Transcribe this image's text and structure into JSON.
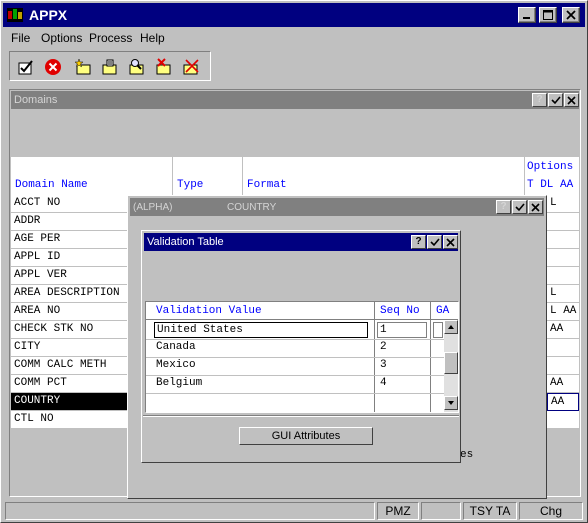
{
  "app": {
    "title": "APPX"
  },
  "menu": [
    "File",
    "Options",
    "Process",
    "Help"
  ],
  "toolbar_icons": [
    "check-doc-icon",
    "cancel-icon",
    "new-doc-icon",
    "edit-doc-icon",
    "find-doc-icon",
    "delete-doc-icon",
    "clear-doc-icon"
  ],
  "domains": {
    "title": "Domains",
    "columns": {
      "name": "Domain Name",
      "type": "Type",
      "format": "Format",
      "options": "Options",
      "opt_sub": "T DL AA"
    },
    "rows": [
      {
        "name": "ACCT NO",
        "opt": "L"
      },
      {
        "name": "ADDR",
        "opt": ""
      },
      {
        "name": "AGE PER",
        "opt": ""
      },
      {
        "name": "APPL ID",
        "opt": ""
      },
      {
        "name": "APPL VER",
        "opt": ""
      },
      {
        "name": "AREA DESCRIPTION",
        "opt": "L"
      },
      {
        "name": "AREA NO",
        "opt": "L AA"
      },
      {
        "name": "CHECK STK NO",
        "opt": "AA"
      },
      {
        "name": "CITY",
        "opt": ""
      },
      {
        "name": "COMM CALC METH",
        "opt": ""
      },
      {
        "name": "COMM PCT",
        "opt": "AA"
      },
      {
        "name": "COUNTRY",
        "opt": "AA"
      },
      {
        "name": "CTL NO",
        "opt": ""
      }
    ],
    "partial_text": "es"
  },
  "country_win": {
    "left_label": "(ALPHA)",
    "title": "COUNTRY"
  },
  "validation": {
    "title": "Validation Table",
    "columns": {
      "value": "Validation Value",
      "seq": "Seq No",
      "ga": "GA"
    },
    "rows": [
      {
        "value": "United States",
        "seq": "1"
      },
      {
        "value": "Canada",
        "seq": "2"
      },
      {
        "value": "Mexico",
        "seq": "3"
      },
      {
        "value": "Belgium",
        "seq": "4"
      }
    ],
    "gui_button": "GUI Attributes"
  },
  "status": {
    "pmz": "PMZ",
    "tsyta": "TSY TA",
    "chg": "Chg"
  }
}
